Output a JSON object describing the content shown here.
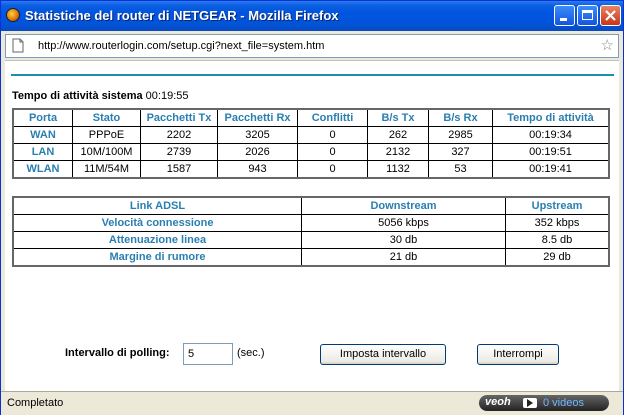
{
  "window": {
    "title": "Statistiche del router di NETGEAR - Mozilla Firefox",
    "url": "http://www.routerlogin.com/setup.cgi?next_file=system.htm",
    "status": "Completato"
  },
  "uptime": {
    "label": "Tempo di attività sistema",
    "value": "00:19:55"
  },
  "stats_table": {
    "headers": [
      "Porta",
      "Stato",
      "Pacchetti Tx",
      "Pacchetti Rx",
      "Conflitti",
      "B/s Tx",
      "B/s Rx",
      "Tempo di attività"
    ],
    "rows": [
      [
        "WAN",
        "PPPoE",
        "2202",
        "3205",
        "0",
        "262",
        "2985",
        "00:19:34"
      ],
      [
        "LAN",
        "10M/100M",
        "2739",
        "2026",
        "0",
        "2132",
        "327",
        "00:19:51"
      ],
      [
        "WLAN",
        "11M/54M",
        "1587",
        "943",
        "0",
        "1132",
        "53",
        "00:19:41"
      ]
    ]
  },
  "adsl_table": {
    "headers": [
      "Link ADSL",
      "Downstream",
      "Upstream"
    ],
    "rows": [
      [
        "Velocità connessione",
        "5056 kbps",
        "352 kbps"
      ],
      [
        "Attenuazione linea",
        "30 db",
        "8.5 db"
      ],
      [
        "Margine di rumore",
        "21 db",
        "29 db"
      ]
    ]
  },
  "polling": {
    "label": "Intervallo di polling:",
    "value": "5",
    "unit": "(sec.)",
    "set_button": "Imposta intervallo",
    "stop_button": "Interrompi"
  },
  "veoh": {
    "logo": "veoh",
    "count": "0  videos"
  },
  "colors": {
    "accent": "#2a7fb0",
    "titlebar": "#0154e1"
  }
}
